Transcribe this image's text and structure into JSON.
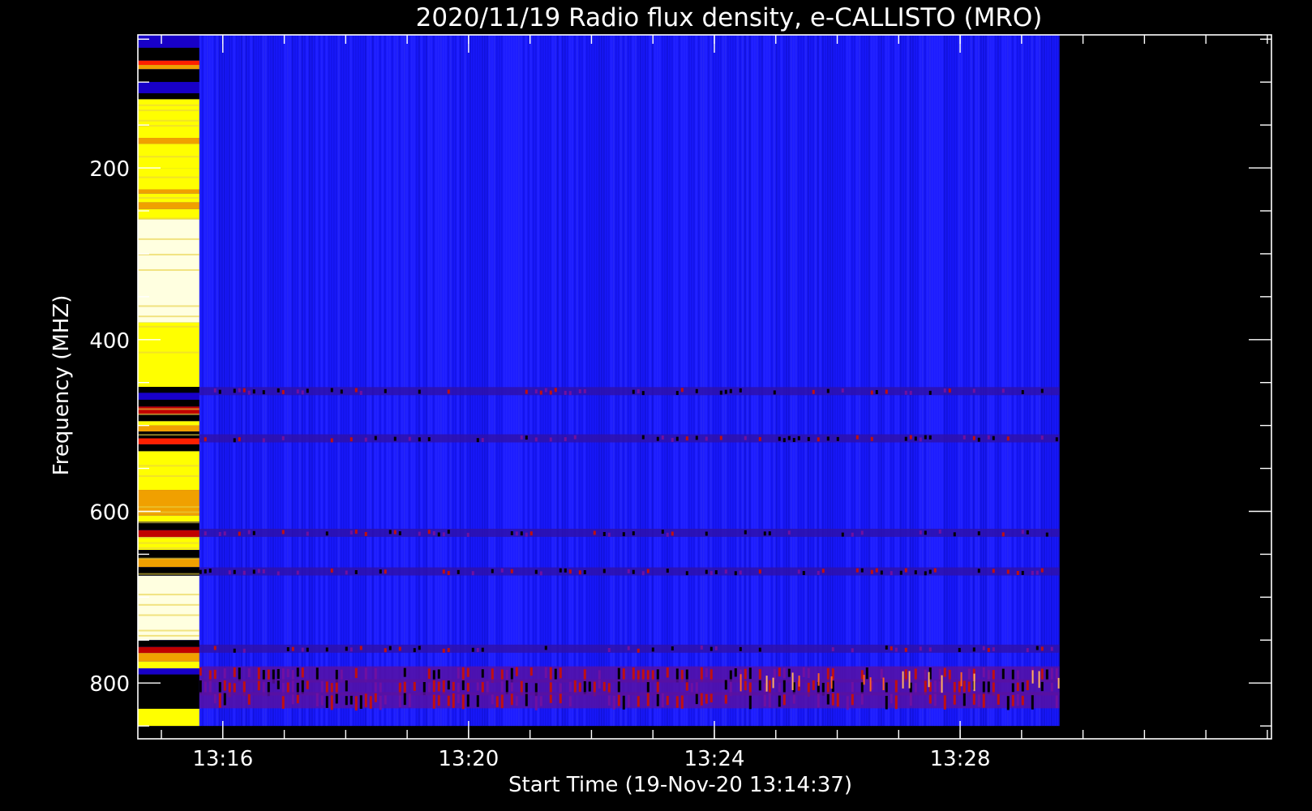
{
  "chart_data": {
    "type": "heatmap",
    "title": "2020/11/19  Radio flux density, e-CALLISTO (MRO)",
    "xlabel": "Start Time (19-Nov-20 13:14:37)",
    "ylabel": "Frequency (MHZ)",
    "x_tick_labels": [
      "13:16",
      "13:20",
      "13:24",
      "13:28"
    ],
    "x_tick_values_min": [
      1.383,
      5.383,
      9.383,
      13.383
    ],
    "x_range_min": [
      0,
      18.45
    ],
    "y_tick_labels": [
      "200",
      "400",
      "600",
      "800"
    ],
    "y_tick_values": [
      200,
      400,
      600,
      800
    ],
    "y_range": [
      45,
      865
    ],
    "y_inverted": true,
    "data_time_range": [
      "13:14:37",
      "13:29:37"
    ],
    "data_freq_range": [
      45,
      850
    ],
    "colormap": [
      "#000000",
      "#1800c8",
      "#2020ff",
      "#c00000",
      "#ff2000",
      "#f0a000",
      "#ffff00",
      "#ffffe0"
    ],
    "features": {
      "initial_calibration_block": {
        "time_range": [
          "13:14:37",
          "13:15:37"
        ],
        "level": "high"
      },
      "background": {
        "level": "low",
        "color": "#1a1aff"
      },
      "interference_bands_mhz": [
        460,
        515,
        625,
        670,
        760,
        790,
        805,
        820
      ]
    }
  }
}
